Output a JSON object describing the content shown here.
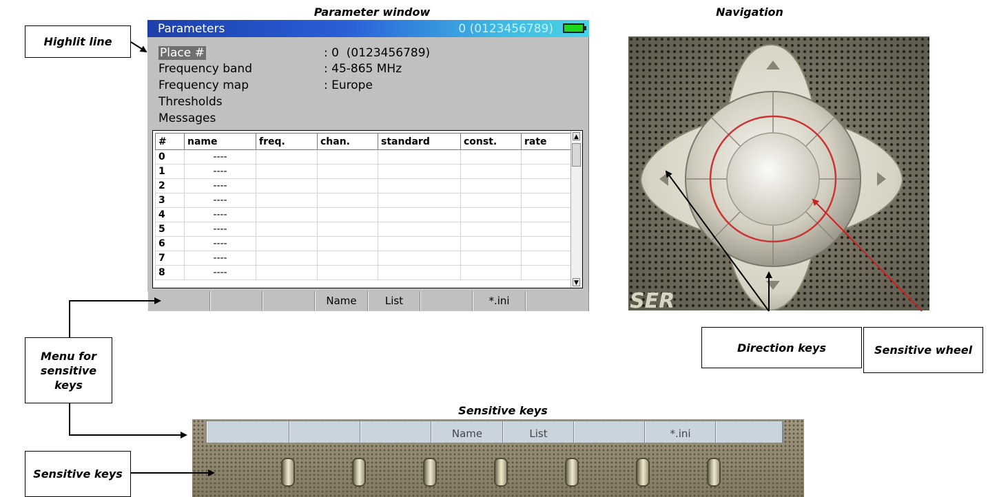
{
  "section_titles": {
    "parameter_window": "Parameter window",
    "navigation": "Navigation",
    "sensitive_keys": "Sensitive keys"
  },
  "callouts": {
    "highlit_line": "Highlit line",
    "menu_for_sensitive_keys": "Menu for sensitive keys",
    "sensitive_keys": "Sensitive keys",
    "direction_keys": "Direction keys",
    "sensitive_wheel": "Sensitive wheel"
  },
  "parameter_window": {
    "title": "Parameters",
    "title_right": "0 (0123456789)",
    "battery_icon": "battery-icon",
    "params": [
      {
        "label": "Place #",
        "value": ": 0  (0123456789)"
      },
      {
        "label": "Frequency band",
        "value": ": 45-865 MHz"
      },
      {
        "label": "Frequency map",
        "value": ": Europe"
      },
      {
        "label": "Thresholds",
        "value": ""
      },
      {
        "label": "Messages",
        "value": ""
      }
    ],
    "table": {
      "headers": [
        "#",
        "name",
        "freq.",
        "chan.",
        "standard",
        "const.",
        "rate"
      ],
      "rows": [
        {
          "num": "0",
          "name": "----"
        },
        {
          "num": "1",
          "name": "----"
        },
        {
          "num": "2",
          "name": "----"
        },
        {
          "num": "3",
          "name": "----"
        },
        {
          "num": "4",
          "name": "----"
        },
        {
          "num": "5",
          "name": "----"
        },
        {
          "num": "6",
          "name": "----"
        },
        {
          "num": "7",
          "name": "----"
        },
        {
          "num": "8",
          "name": "----"
        }
      ]
    },
    "menu": [
      "",
      "",
      "",
      "Name",
      "List",
      "",
      "*.ini",
      ""
    ]
  },
  "navigation_photo": {
    "brand_fragment": "SER",
    "icons": [
      "up-arrow-icon",
      "down-arrow-icon",
      "left-arrow-icon",
      "right-arrow-icon"
    ]
  },
  "sensitive_keys_photo": {
    "menu": [
      "",
      "",
      "",
      "Name",
      "List",
      "",
      "*.ini",
      ""
    ]
  },
  "colors": {
    "title_bar_start": "#1d3fa9",
    "title_bar_end": "#48d3e6",
    "battery": "#1fd61f",
    "highlight": "#6f6f6f",
    "wheel_circle": "#cc3333",
    "arrow_black": "#000000",
    "arrow_red": "#cc2222"
  }
}
